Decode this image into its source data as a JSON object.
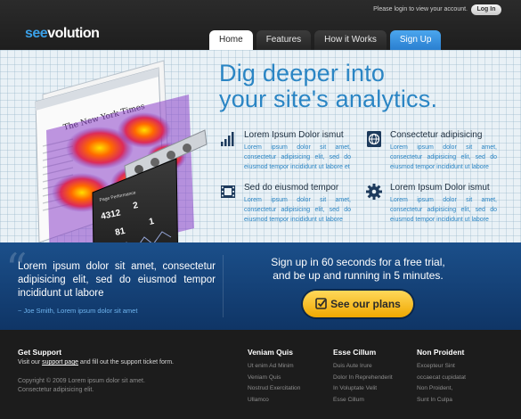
{
  "header": {
    "login_text": "Please login to view your account.",
    "login_button": "Log In",
    "logo_part1": "see",
    "logo_part2": "volution",
    "nav": [
      {
        "label": "Home"
      },
      {
        "label": "Features"
      },
      {
        "label": "How it Works"
      },
      {
        "label": "Sign Up"
      }
    ]
  },
  "hero": {
    "title_line1": "Dig deeper into",
    "title_line2": "your site's analytics.",
    "features": [
      {
        "title": "Lorem Ipsum Dolor ismut",
        "icon": "bar-chart-icon",
        "text": "Lorem ipsum dolor sit amet, consectetur adipisicing elit, sed do eiusmod tempor incididunt ut labore et"
      },
      {
        "title": "Consectetur adipisicing",
        "icon": "globe-document-icon",
        "text": "Lorem ipsum dolor sit amet, consectetur adipisicing elit, sed do eiusmod tempor incididunt ut labore"
      },
      {
        "title": "Sed do eiusmod tempor",
        "icon": "film-strip-icon",
        "text": "Lorem ipsum dolor sit amet, consectetur adipisicing elit, sed do eiusmod tempor incididunt ut labore"
      },
      {
        "title": "Lorem Ipsum Dolor ismut",
        "icon": "gear-icon",
        "text": "Lorem ipsum dolor sit amet, consectetur adipisicing elit, sed do eiusmod tempor incididunt ut labore"
      }
    ],
    "mockup": {
      "masthead": "The New York Times",
      "panel_title": "Page Performance",
      "stats": [
        "4312",
        "2",
        "81",
        "1"
      ]
    }
  },
  "band": {
    "quote": "Lorem ipsum dolor sit amet, consectetur adipisicing elit, sed do eiusmod tempor incididunt ut labore",
    "author": "~ Joe Smith, Lorem ipsum dolor sit amet",
    "cta_line1": "Sign up in 60 seconds for a free trial,",
    "cta_line2": "and be up and running in 5 minutes.",
    "cta_button": "See our plans"
  },
  "footer": {
    "support_heading": "Get Support",
    "support_text_before": "Visit our ",
    "support_link": "support page",
    "support_text_after": " and fill out the support ticket form.",
    "copyright_line1": "Copyright © 2009 Lorem ipsum dolor sit amet.",
    "copyright_line2": "Consectetur adipisicing elit.",
    "columns": [
      {
        "heading": "Veniam Quis",
        "links": [
          "Ut enim Ad Minim",
          "Veniam Quis",
          "Nostrud Exercitation",
          "Ullamco"
        ]
      },
      {
        "heading": "Esse Cillum",
        "links": [
          "Duis Aute Irure",
          "Dolor In Reprehenderit",
          "In Voluptate Velit",
          "Esse Cillum"
        ]
      },
      {
        "heading": "Non Proident",
        "links": [
          "Excepteur Sint",
          "occaecat cupidatat",
          "Non Proident,",
          "Sunt In Culpa"
        ]
      }
    ]
  },
  "colors": {
    "accent_blue": "#2a85c4",
    "band_blue": "#1b4f8a",
    "cta_yellow": "#f5b800"
  }
}
